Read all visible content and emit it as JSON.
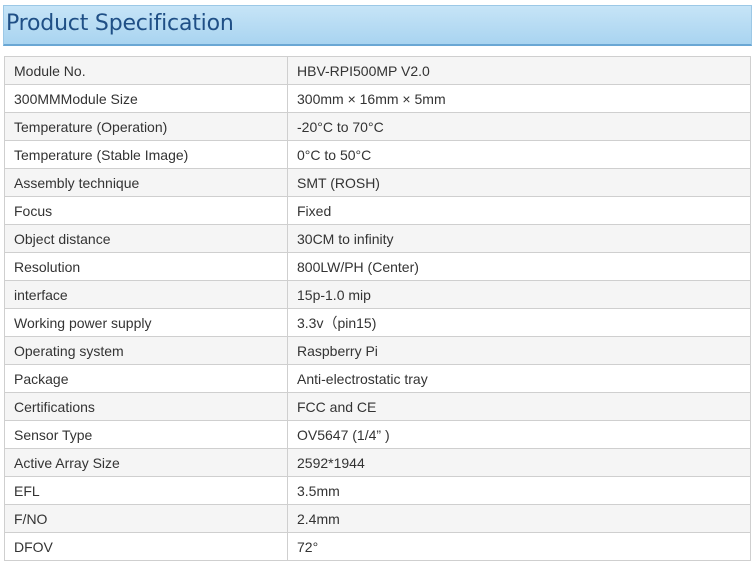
{
  "header": {
    "title": "Product Specification"
  },
  "spec_table": {
    "rows": [
      {
        "label": "Module No.",
        "value": "HBV-RPI500MP V2.0"
      },
      {
        "label": "300MMModule Size",
        "value": "300mm × 16mm × 5mm"
      },
      {
        "label": "Temperature (Operation)",
        "value": "-20°C to 70°C"
      },
      {
        "label": "Temperature (Stable Image)",
        "value": "0°C to 50°C"
      },
      {
        "label": "Assembly technique",
        "value": "SMT (ROSH)"
      },
      {
        "label": "Focus",
        "value": "Fixed"
      },
      {
        "label": "Object distance",
        "value": "30CM to  infinity"
      },
      {
        "label": "Resolution",
        "value": "800LW/PH (Center)"
      },
      {
        "label": "interface",
        "value": "15p-1.0 mip"
      },
      {
        "label": "Working power supply",
        "value": "3.3v（pin15)"
      },
      {
        "label": "Operating system",
        "value": "Raspberry Pi"
      },
      {
        "label": "Package",
        "value": "Anti-electrostatic tray"
      },
      {
        "label": "Certifications",
        "value": "FCC and CE"
      },
      {
        "label": "Sensor Type",
        "value": "OV5647 (1/4” )"
      },
      {
        "label": "Active Array Size",
        "value": "2592*1944"
      },
      {
        "label": "EFL",
        "value": "3.5mm"
      },
      {
        "label": "F/NO",
        "value": "2.4mm"
      },
      {
        "label": "DFOV",
        "value": "72°"
      }
    ]
  }
}
